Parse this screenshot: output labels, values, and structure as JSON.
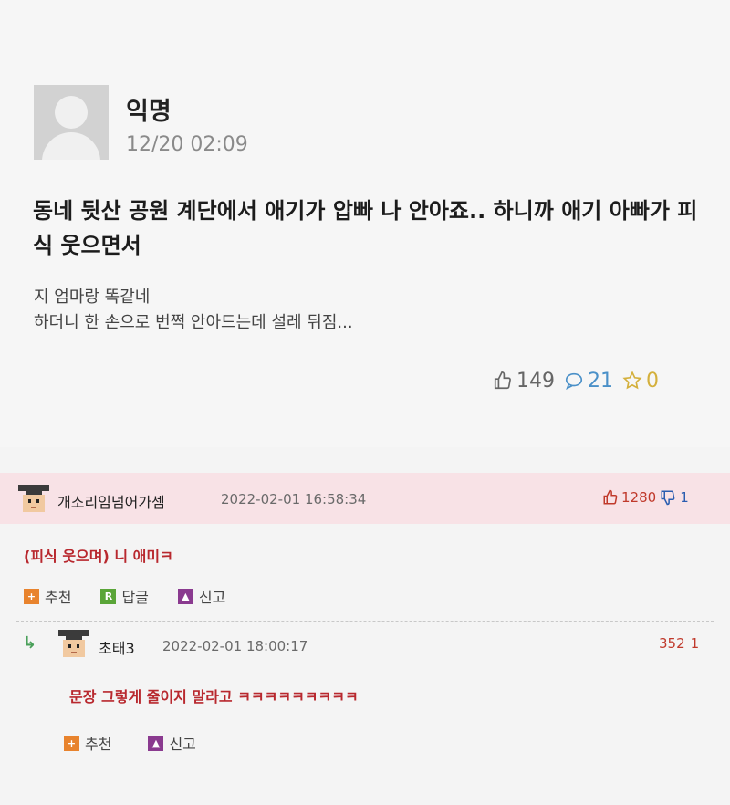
{
  "post": {
    "author": "익명",
    "timestamp": "12/20 02:09",
    "title": "동네 뒷산 공원 계단에서 애기가 압빠 나 안아죠.. 하니까 애기 아빠가 피식 웃으면서",
    "body_line1": "지 엄마랑 똑같네",
    "body_line2": "하더니 한 손으로 번쩍 안아드는데 설레 뒤짐...",
    "likes": "149",
    "comments": "21",
    "scraps": "0"
  },
  "comment": {
    "author": "개소리임넘어가셈",
    "timestamp": "2022-02-01 16:58:34",
    "upvotes": "1280",
    "downvotes": "1",
    "text": "(피식 웃으며) 니 애미ㅋ",
    "actions": {
      "recommend": "추천",
      "reply": "답글",
      "report": "신고"
    },
    "reply_icon_letter": "R"
  },
  "reply": {
    "author": "초태3",
    "timestamp": "2022-02-01 18:00:17",
    "upvotes": "352",
    "downvotes": "1",
    "text": "문장 그렇게 줄이지 말라고 ㅋㅋㅋㅋㅋㅋㅋㅋㅋ",
    "actions": {
      "recommend": "추천",
      "report": "신고"
    }
  },
  "colors": {
    "comment_header_bg": "#f8e2e6",
    "comment_text": "#b8282e",
    "upvote": "#c0392b",
    "downvote": "#2a5db0"
  }
}
